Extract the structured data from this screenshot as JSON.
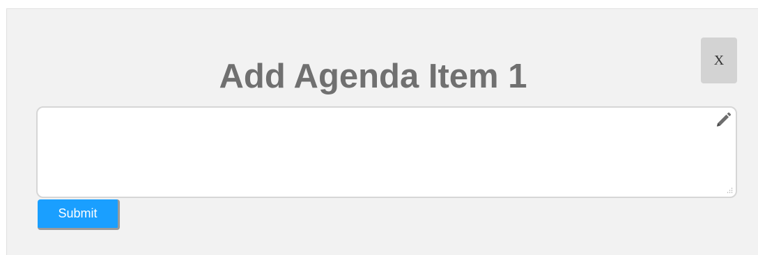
{
  "dialog": {
    "title": "Add Agenda Item 1",
    "close_label": "X"
  },
  "editor": {
    "value": "",
    "placeholder": "",
    "edit_icon": "pencil-icon",
    "resize_icon": "resize-grip-icon"
  },
  "actions": {
    "submit_label": "Submit"
  },
  "colors": {
    "panel_bg": "#f2f2f2",
    "title": "#707070",
    "submit_bg": "#1a9fff",
    "close_bg": "#d3d3d3"
  }
}
